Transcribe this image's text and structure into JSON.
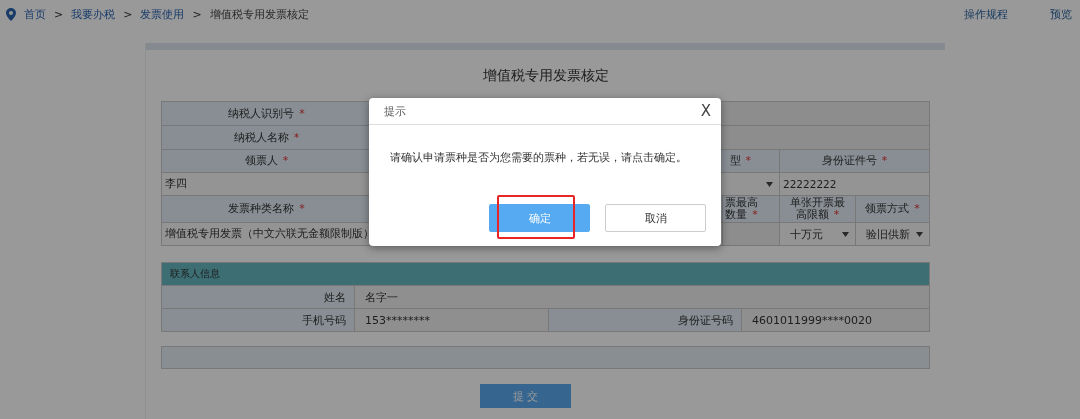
{
  "breadcrumb": [
    {
      "label": "首页",
      "kind": "link"
    },
    {
      "label": ">",
      "kind": "separator"
    },
    {
      "label": "我要办税",
      "kind": "link"
    },
    {
      "label": ">",
      "kind": "separator"
    },
    {
      "label": "发票使用",
      "kind": "link"
    },
    {
      "label": ">",
      "kind": "separator"
    },
    {
      "label": "增值税专用发票核定",
      "kind": "current"
    }
  ],
  "top_links": [
    "操作规程",
    "预览"
  ],
  "form": {
    "title": "增值税专用发票核定",
    "taxpayer_fields": [
      {
        "label": "纳税人识别号",
        "mark": "*"
      },
      {
        "label": "纳税人名称",
        "mark": "*"
      }
    ],
    "recipient": {
      "name_header": {
        "label": "领票人",
        "mark": "*"
      },
      "type_header": {
        "label": "型",
        "mark": "*"
      },
      "id_header": {
        "label": "身份证件号",
        "mark": "*"
      },
      "name": "李四",
      "id_number": "22222222"
    },
    "invoice": {
      "type_header": {
        "label": "发票种类名称",
        "mark": "*"
      },
      "count_header": {
        "lines": [
          "票最高",
          "数量"
        ],
        "mark": "*"
      },
      "limit_header": {
        "lines": [
          "单张开票最",
          "高限额"
        ],
        "mark": "*"
      },
      "method_header": {
        "label": "领票方式",
        "mark": "*"
      },
      "type_value": "增值税专用发票（中文六联无金额限制版）",
      "limit": "十万元",
      "method": "验旧供新"
    },
    "contact": {
      "title": "联系人信息",
      "name_label": "姓名",
      "name": "名字一",
      "phone_label": "手机号码",
      "phone": "153********",
      "id_label": "身份证号码",
      "id": "4601011999****0020"
    },
    "submit": "提 交"
  },
  "dialog": {
    "title": "提示",
    "close": "X",
    "message": "请确认申请票种是否为您需要的票种，若无误，请点击确定。",
    "buttons": [
      {
        "label": "确定",
        "kind": "primary",
        "highlighted": true
      },
      {
        "label": "取消",
        "kind": "default",
        "highlighted": false
      }
    ]
  }
}
